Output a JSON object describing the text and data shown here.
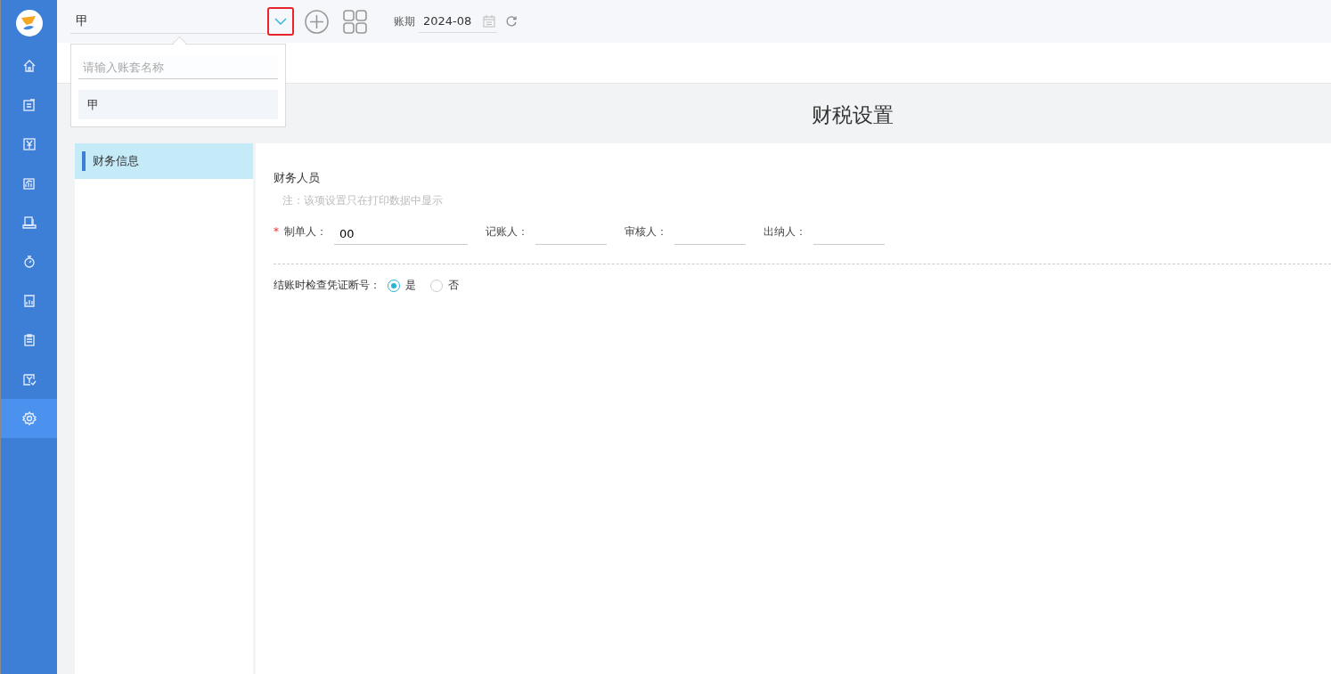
{
  "sidebar": {
    "items": [
      {
        "kind": "home",
        "selected": false
      },
      {
        "kind": "edit",
        "selected": false
      },
      {
        "kind": "money",
        "selected": false
      },
      {
        "kind": "chart",
        "selected": false
      },
      {
        "kind": "desk",
        "selected": false
      },
      {
        "kind": "timer",
        "selected": false
      },
      {
        "kind": "report",
        "selected": false
      },
      {
        "kind": "clipboard",
        "selected": false
      },
      {
        "kind": "check",
        "selected": false
      },
      {
        "kind": "settings",
        "selected": true
      }
    ]
  },
  "topbar": {
    "account": "甲",
    "period_label": "账期",
    "period": "2024-08"
  },
  "account_dropdown": {
    "placeholder": "请输入账套名称",
    "options": [
      {
        "label": "甲",
        "selected": true
      }
    ]
  },
  "page": {
    "title": "财税设置",
    "menu": [
      {
        "label": "财务信息",
        "selected": true
      }
    ],
    "section_title": "财务人员",
    "note": "注：该项设置只在打印数据中显示",
    "required_mark": "*",
    "fields": [
      {
        "label": "制单人：",
        "value": "00",
        "required": true
      },
      {
        "label": "记账人：",
        "required": false
      },
      {
        "label": "审核人：",
        "required": false
      },
      {
        "label": "出纳人：",
        "required": false
      }
    ],
    "check_label": "结账时检查凭证断号：",
    "check_options": [
      {
        "label": "是",
        "selected": true
      },
      {
        "label": "否",
        "selected": false
      }
    ]
  }
}
